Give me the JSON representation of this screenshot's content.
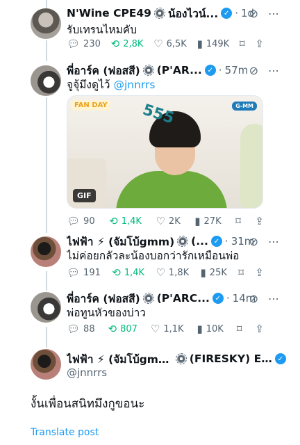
{
  "tweets": [
    {
      "name": "N'Wine CPE49",
      "display_suffix": "น้องไวน์...",
      "time": "1d",
      "text": "รับเทรนไหมคับ",
      "replies": "230",
      "retweets": "2,8K",
      "likes": "6,5K",
      "views": "149K"
    },
    {
      "name": "พี่อาร์ค (ฟอสสี)",
      "display_suffix": "(P'AR...",
      "time": "57m",
      "text_prefix": "จูจุ้มึงดูไว้ ",
      "mention": "@jnnrrs",
      "media": {
        "logo_left": "FAN DAY",
        "logo_right": "G-MM",
        "sticker": "555",
        "badge": "GIF"
      },
      "replies": "90",
      "retweets": "1,4K",
      "likes": "2K",
      "views": "27K"
    },
    {
      "name": "ไฟฟ้า ⚡ (จัมโบ้gmm)",
      "display_suffix": "(...",
      "time": "31m",
      "text": "ไม่ค่อยกลัวละน้องบอกว่ารักเหมือนพ่อ",
      "replies": "191",
      "retweets": "1,4K",
      "likes": "1,8K",
      "views": "25K"
    },
    {
      "name": "พี่อาร์ค (ฟอสสี)",
      "display_suffix": "(P'ARC...",
      "time": "14m",
      "text": "พ่อทูนหัวของบ่าว",
      "replies": "88",
      "retweets": "807",
      "likes": "1,1K",
      "views": "10K"
    }
  ],
  "main_tweet": {
    "name": "ไฟฟ้า ⚡ (จัมโบ้gmm)",
    "display_suffix": "(FIRESKY) E...",
    "handle": "@jnnrrs",
    "text": "งั้นเพื่อนสนิทมึงกูขอนะ",
    "translate_label": "Translate post"
  },
  "icons": {
    "reply": "reply-icon",
    "retweet": "retweet-icon",
    "like": "heart-icon",
    "views": "views-icon",
    "bookmark": "bookmark-icon",
    "share": "share-icon",
    "grok": "grok-icon",
    "more": "more-icon",
    "verified": "verified-badge-icon",
    "affiliate": "affiliate-gear-icon"
  },
  "colors": {
    "accent": "#1d9bf0",
    "retweet": "#00ba7c",
    "muted": "#536471"
  }
}
